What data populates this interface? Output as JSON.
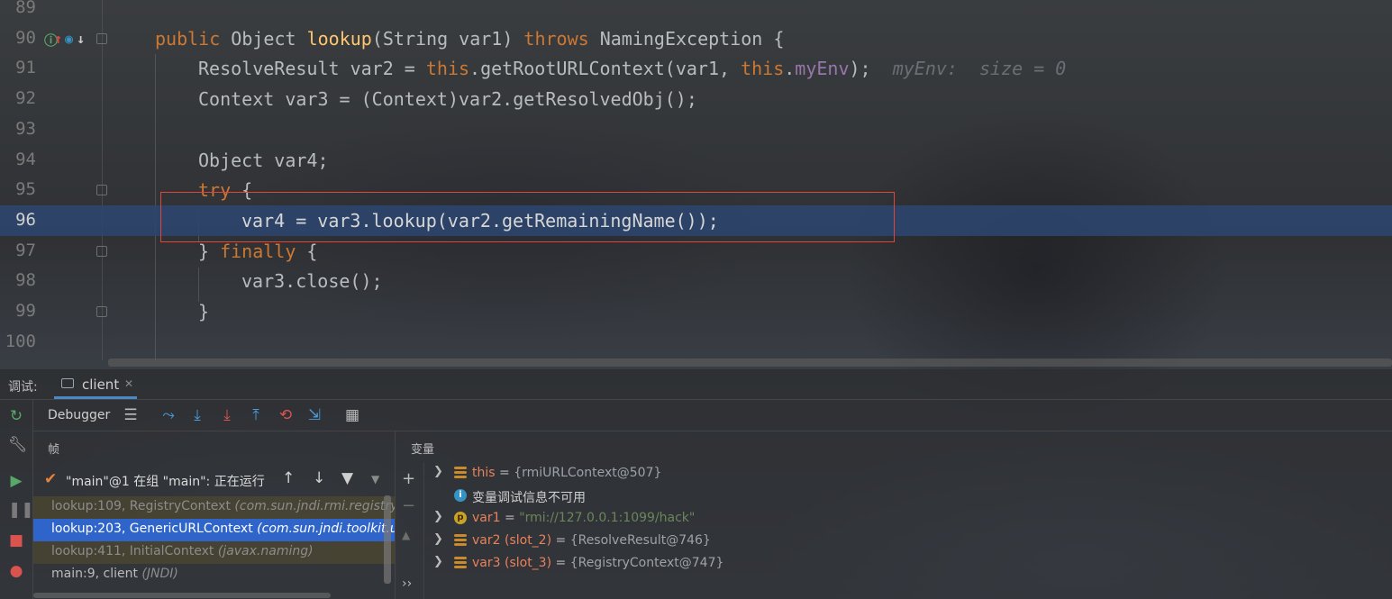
{
  "editor": {
    "lines": [
      {
        "n": "89"
      },
      {
        "n": "90"
      },
      {
        "n": "91"
      },
      {
        "n": "92"
      },
      {
        "n": "93"
      },
      {
        "n": "94"
      },
      {
        "n": "95"
      },
      {
        "n": "96"
      },
      {
        "n": "97"
      },
      {
        "n": "98"
      },
      {
        "n": "99"
      },
      {
        "n": "100"
      }
    ],
    "code": {
      "l90": [
        "public",
        " Object ",
        "lookup",
        "(String var1) ",
        "throws",
        " NamingException {"
      ],
      "l91": [
        "ResolveResult var2 = ",
        "this",
        ".getRootURLContext(var1, ",
        "this",
        ".",
        "myEnv",
        ");",
        "  myEnv:  size = 0"
      ],
      "l92": [
        "Context var3 = (Context)var2.getResolvedObj();"
      ],
      "l94": [
        "Object var4;"
      ],
      "l95": [
        "try",
        " {"
      ],
      "l96": [
        "var4 = var3.lookup(var2.getRemainingName());"
      ],
      "l97": [
        "} ",
        "finally",
        " {"
      ],
      "l98": [
        "var3.close();"
      ],
      "l99": [
        "}"
      ]
    },
    "current_line": "96"
  },
  "debug": {
    "label": "调试:",
    "tab": "client",
    "toolbar_label": "Debugger",
    "frames_header": "帧",
    "thread": "\"main\"@1 在组 \"main\": 正在运行",
    "frames": [
      {
        "method": "lookup:109, RegistryContext ",
        "pkg": "(com.sun.jndi.rmi.registry)"
      },
      {
        "method": "lookup:203, GenericURLContext ",
        "pkg": "(com.sun.jndi.toolkit.url)"
      },
      {
        "method": "lookup:411, InitialContext ",
        "pkg": "(javax.naming)"
      },
      {
        "method": "main:9, client ",
        "pkg": "(JNDI)"
      }
    ],
    "vars_header": "变量",
    "variables": [
      {
        "name": "this",
        "eq": " = ",
        "value": "{rmiURLContext@507}"
      },
      {
        "info": "变量调试信息不可用"
      },
      {
        "name": "var1",
        "eq": " = ",
        "value": "\"rmi://127.0.0.1:1099/hack\""
      },
      {
        "name": "var2 (slot_2)",
        "eq": " = ",
        "value": "{ResolveResult@746}"
      },
      {
        "name": "var3 (slot_3)",
        "eq": " = ",
        "value": "{RegistryContext@747}"
      }
    ],
    "more": "››"
  },
  "colors": {
    "keyword": "#cc7832",
    "method": "#ffc66d",
    "field": "#9876aa",
    "selection": "#2f65ca",
    "highlight_box": "#e0453c"
  }
}
